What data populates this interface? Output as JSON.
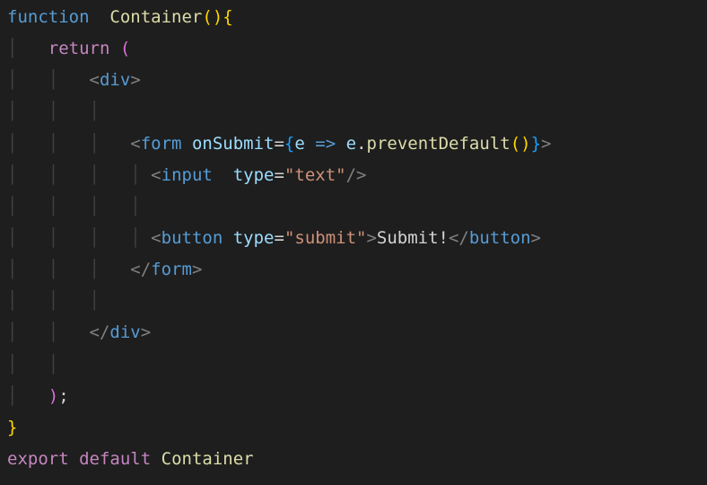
{
  "code": {
    "kw_function": "function",
    "fn_name": "Container",
    "kw_return": "return",
    "tag_div": "div",
    "tag_form": "form",
    "attr_onSubmit": "onSubmit",
    "param_e": "e",
    "method_preventDefault": "preventDefault",
    "tag_input": "input",
    "attr_type": "type",
    "str_text": "\"text\"",
    "tag_button": "button",
    "str_submit": "\"submit\"",
    "btn_text": "Submit!",
    "kw_export": "export",
    "kw_default": "default",
    "id_Container": "Container",
    "punct_lparen": "(",
    "punct_rparen": ")",
    "punct_lbrace": "{",
    "punct_rbrace": "}",
    "punct_lt": "<",
    "punct_gt": ">",
    "punct_ltslash": "</",
    "punct_slashgt": "/>",
    "punct_eq": "=",
    "punct_arrow": "=>",
    "punct_dot": ".",
    "punct_semi": ";"
  }
}
